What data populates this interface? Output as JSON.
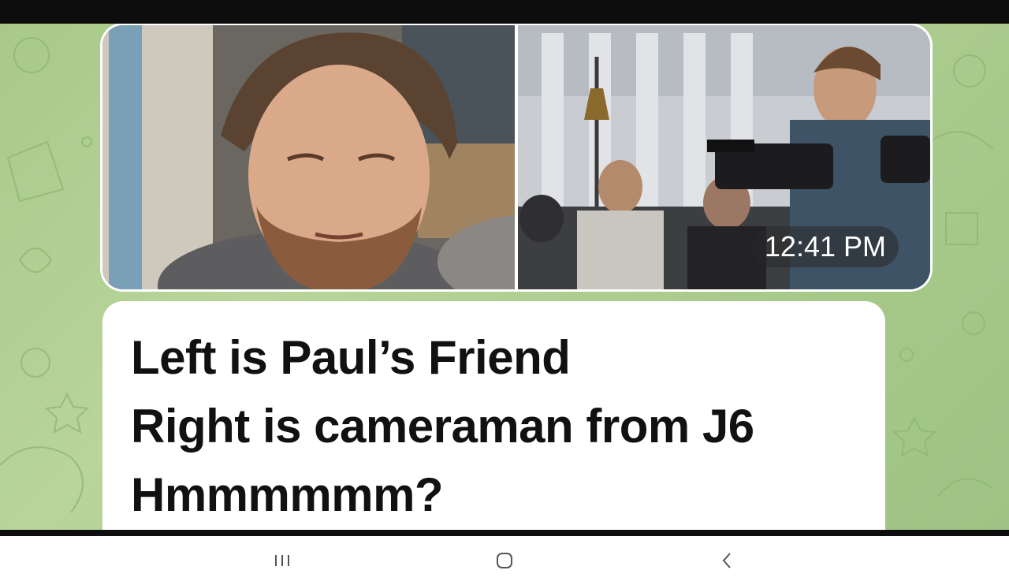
{
  "message": {
    "timestamp": "12:41 PM",
    "lines": [
      "Left is Paul’s Friend",
      "Right is cameraman from J6",
      "Hmmmmmm?"
    ],
    "photos": [
      {
        "subject": "man-portrait"
      },
      {
        "subject": "cameraman-crowd"
      }
    ]
  },
  "nav": {
    "recents_icon": "recents-icon",
    "home_icon": "home-icon",
    "back_icon": "back-icon"
  },
  "colors": {
    "wallpaper": "#b9d59a",
    "bubble": "#ffffff",
    "text": "#111111",
    "time_badge": "#555555"
  }
}
